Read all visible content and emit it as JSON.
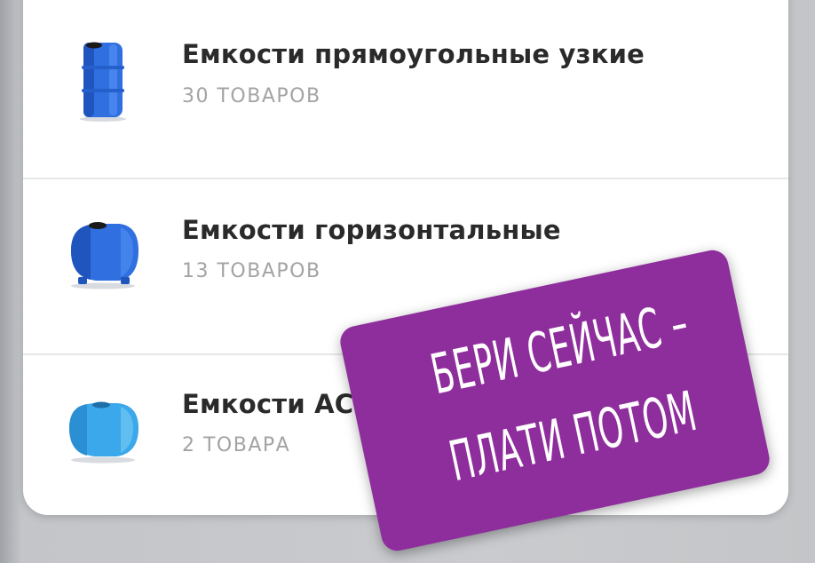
{
  "categories": [
    {
      "title": "Емкости прямоугольные узкие",
      "count": "30 ТОВАРОВ",
      "icon": "tank-rectangular-narrow-icon"
    },
    {
      "title": "Емкости горизонтальные",
      "count": "13 ТОВАРОВ",
      "icon": "tank-horizontal-icon"
    },
    {
      "title": "Емкости АС",
      "count": "2 ТОВАРА",
      "icon": "tank-light-blue-icon"
    }
  ],
  "promo": {
    "line1": "БЕРИ СЕЙЧАС –",
    "line2": "ПЛАТИ ПОТОМ"
  },
  "colors": {
    "promo_background": "#8e2e9c",
    "tank_blue": "#2f6fe0",
    "tank_light_blue": "#3aa8ea"
  }
}
